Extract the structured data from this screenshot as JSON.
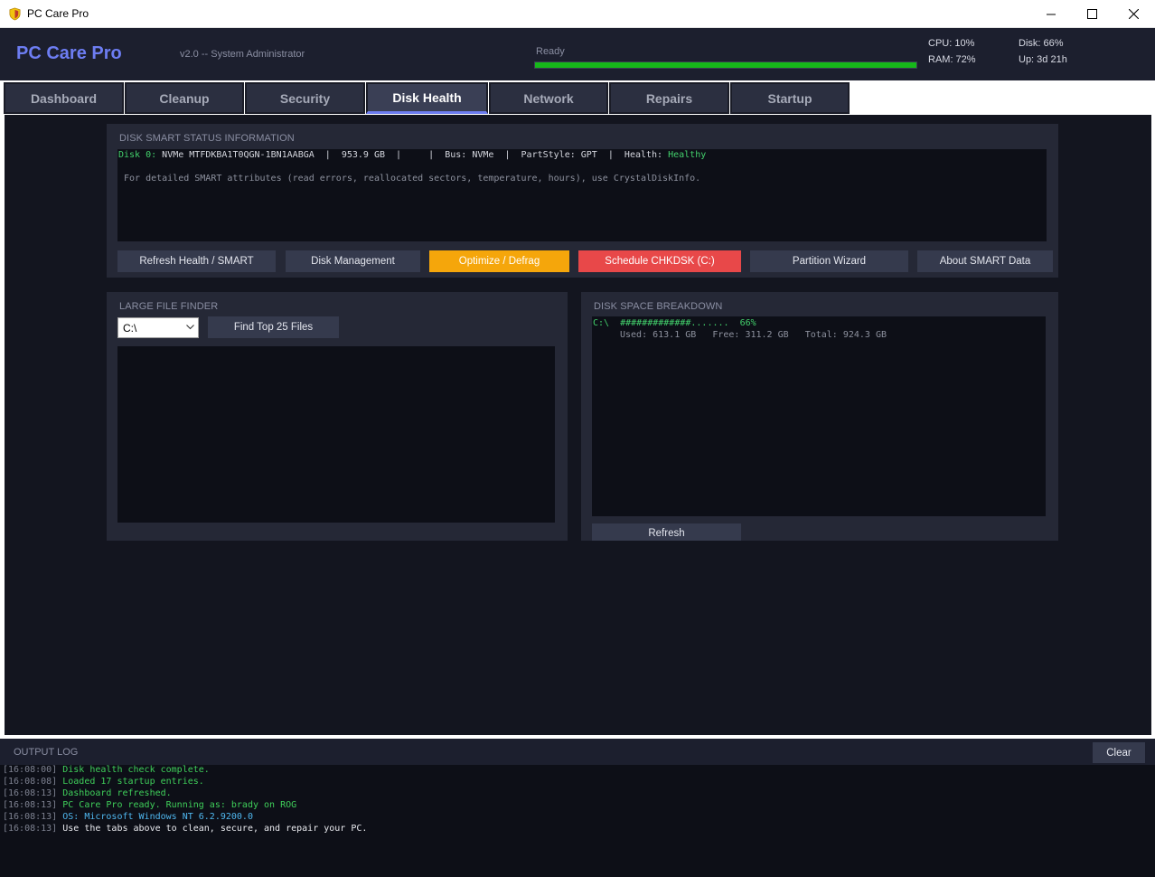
{
  "window": {
    "title": "PC Care Pro"
  },
  "header": {
    "brand": "PC Care Pro",
    "version": "v2.0  --  System Administrator",
    "status": "Ready",
    "progress": 1.0,
    "cpu": "CPU: 10%",
    "ram": "RAM: 72%",
    "disk": "Disk: 66%",
    "uptime": "Up: 3d 21h"
  },
  "tabs": [
    {
      "label": "Dashboard"
    },
    {
      "label": "Cleanup"
    },
    {
      "label": "Security"
    },
    {
      "label": "Disk Health",
      "active": true
    },
    {
      "label": "Network"
    },
    {
      "label": "Repairs"
    },
    {
      "label": "Startup"
    }
  ],
  "smart": {
    "title": "DISK SMART STATUS  INFORMATION",
    "disk_label": "Disk 0:",
    "disk_info": " NVMe MTFDKBA1T0QGN-1BN1AABGA  |  953.9 GB  |     |  Bus: NVMe  |  PartStyle: GPT  |  Health: ",
    "health": "Healthy",
    "note": "For detailed SMART attributes (read errors, reallocated sectors, temperature, hours), use CrystalDiskInfo.",
    "buttons": {
      "refresh": "Refresh Health / SMART",
      "disk_mgmt": "Disk Management",
      "optimize": "Optimize / Defrag",
      "chkdsk": "Schedule CHKDSK (C:)",
      "partition": "Partition Wizard",
      "about": "About SMART Data"
    }
  },
  "large_files": {
    "title": "LARGE FILE FINDER",
    "drive": "C:\\",
    "find_button": "Find Top 25 Files"
  },
  "space": {
    "title": "DISK SPACE BREAKDOWN",
    "drive": "C:\\",
    "bar": "#############.......",
    "percent": "66%",
    "details": "Used: 613.1 GB   Free: 311.2 GB   Total: 924.3 GB",
    "refresh_button": "Refresh"
  },
  "log": {
    "title": "OUTPUT LOG",
    "clear_button": "Clear",
    "entries": [
      {
        "time": "[16:08:00]",
        "text": "Disk health check complete.",
        "color": "#3fcf5a"
      },
      {
        "time": "[16:08:08]",
        "text": "Loaded 17 startup entries.",
        "color": "#3fcf5a"
      },
      {
        "time": "[16:08:13]",
        "text": "Dashboard refreshed.",
        "color": "#3fcf5a"
      },
      {
        "time": "[16:08:13]",
        "text": "PC Care Pro ready. Running as: brady on ROG",
        "color": "#3fcf5a"
      },
      {
        "time": "[16:08:13]",
        "text": "OS: Microsoft Windows NT 6.2.9200.0",
        "color": "#4fb7ef"
      },
      {
        "time": "[16:08:13]",
        "text": "Use the tabs above to clean, secure, and repair your PC.",
        "color": "#e8e9ee"
      }
    ]
  }
}
